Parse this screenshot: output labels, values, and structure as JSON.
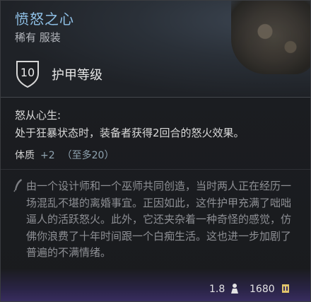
{
  "item": {
    "name": "愤怒之心",
    "rarity_type": "稀有 服装"
  },
  "armor": {
    "value": "10",
    "label": "护甲等级"
  },
  "ability": {
    "title": "怒从心生:",
    "description": "处于狂暴状态时，装备者获得2回合的怒火效果。"
  },
  "stat": {
    "name": "体质",
    "value": "+2",
    "max": "（至多20）"
  },
  "lore": {
    "text": "由一个设计师和一个巫师共同创造，当时两人正在经历一场混乱不堪的离婚事宜。正因如此，这件护甲充满了咄咄逼人的活跃怒火。此外，它还夹杂着一种奇怪的感觉，仿佛你浪费了十年时间跟一个白痴生活。这也进一步加剧了普遍的不满情绪。"
  },
  "footer": {
    "weight": "1.8",
    "price": "1680"
  },
  "icons": {
    "armor": "shield-icon",
    "lore": "quill-icon",
    "weight": "weight-icon",
    "price": "coin-icon"
  }
}
